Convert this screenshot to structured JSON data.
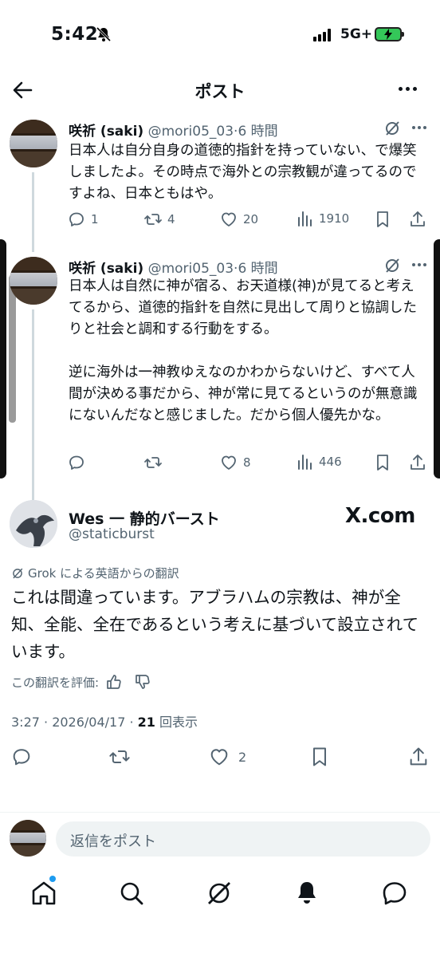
{
  "status_bar": {
    "time": "5:42",
    "network": "5G+",
    "icons": [
      "bell-slash-icon",
      "signal-icon",
      "battery-charging-icon"
    ],
    "battery_color": "#34c759"
  },
  "header": {
    "title": "ポスト",
    "icons": [
      "back-arrow-icon",
      "more-icon"
    ]
  },
  "thread": [
    {
      "name": "咲祈 (saki)",
      "handle": "@mori05_03",
      "time": "6 時間",
      "paragraphs": [
        "日本人は自分自身の道徳的指針を持っていない、で爆笑しましたよ。その時点で海外との宗教観が違ってるのですよね、日本ともはや。"
      ],
      "replies": "1",
      "reposts": "4",
      "likes": "20",
      "views": "1910"
    },
    {
      "name": "咲祈 (saki)",
      "handle": "@mori05_03",
      "time": "6 時間",
      "paragraphs": [
        "日本人は自然に神が宿る、お天道様(神)が見てると考えてるから、道徳的指針を自然に見出して周りと協調したりと社会と調和する行動をする。",
        "逆に海外は一神教ゆえなのかわからないけど、すべて人間が決める事だから、神が常に見てるというのが無意識にないんだなと感じました。だから個人優先かな。"
      ],
      "replies": "",
      "reposts": "",
      "likes": "8",
      "views": "446"
    }
  ],
  "main_post": {
    "name": "Wes 一 静的バースト",
    "handle": "@staticburst",
    "watermark": "X.com",
    "translation_note": "Grok による英語からの翻訳",
    "text": "これは間違っています。アブラハムの宗教は、神が全知、全能、全在であるという考えに基づいて設立されています。",
    "rate_label": "この翻訳を評価:",
    "timestamp": "3:27 · 2026/04/17 · ",
    "view_count": "21",
    "view_label": " 回表示",
    "likes": "2"
  },
  "reply_bar": {
    "placeholder": "返信をポスト"
  },
  "tab_bar": {
    "tabs": [
      "home-icon",
      "search-icon",
      "grok-icon",
      "notifications-icon",
      "messages-icon"
    ],
    "accent": "#1d9bf0"
  }
}
